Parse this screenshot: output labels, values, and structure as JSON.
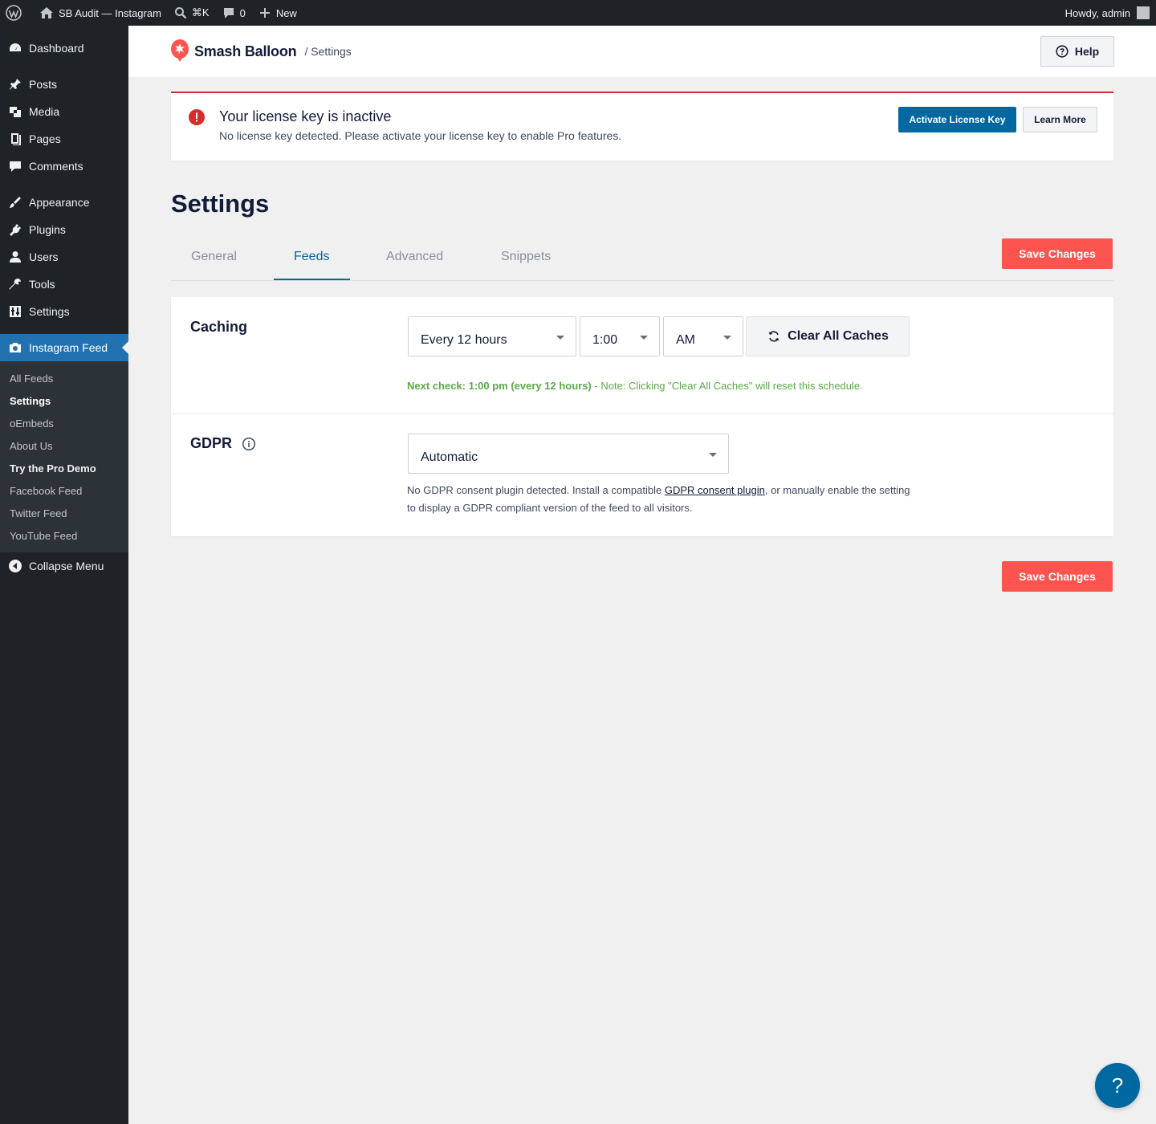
{
  "adminbar": {
    "site_name": "SB Audit — Instagram",
    "shortcut": "⌘K",
    "comments_count": "0",
    "new_label": "New",
    "greeting": "Howdy, admin"
  },
  "sidebar": {
    "items": [
      {
        "label": "Dashboard",
        "icon": "dashboard-icon"
      },
      {
        "label": "Posts",
        "icon": "pin-icon"
      },
      {
        "label": "Media",
        "icon": "media-icon"
      },
      {
        "label": "Pages",
        "icon": "pages-icon"
      },
      {
        "label": "Comments",
        "icon": "comment-icon"
      },
      {
        "label": "Appearance",
        "icon": "brush-icon"
      },
      {
        "label": "Plugins",
        "icon": "plugin-icon"
      },
      {
        "label": "Users",
        "icon": "user-icon"
      },
      {
        "label": "Tools",
        "icon": "wrench-icon"
      },
      {
        "label": "Settings",
        "icon": "settings-icon"
      },
      {
        "label": "Instagram Feed",
        "icon": "camera-icon"
      }
    ],
    "submenu": [
      "All Feeds",
      "Settings",
      "oEmbeds",
      "About Us",
      "Try the Pro Demo",
      "Facebook Feed",
      "Twitter Feed",
      "YouTube Feed"
    ],
    "collapse_label": "Collapse Menu"
  },
  "header": {
    "brand": "Smash Balloon",
    "breadcrumb": "/ Settings",
    "help_label": "Help"
  },
  "notice": {
    "title": "Your license key is inactive",
    "description": "No license key detected. Please activate your license key to enable Pro features.",
    "activate_label": "Activate License Key",
    "learn_label": "Learn More"
  },
  "page": {
    "title": "Settings",
    "tabs": [
      "General",
      "Feeds",
      "Advanced",
      "Snippets"
    ],
    "active_tab": "Feeds",
    "save_label": "Save Changes"
  },
  "caching": {
    "label": "Caching",
    "frequency": "Every 12 hours",
    "time": "1:00",
    "ampm": "AM",
    "clear_label": "Clear All Caches",
    "next_check": "Next check: 1:00 pm (every 12 hours)",
    "note": " - Note: Clicking \"Clear All Caches\" will reset this schedule."
  },
  "gdpr": {
    "label": "GDPR",
    "value": "Automatic",
    "desc_before": "No GDPR consent plugin detected. Install a compatible ",
    "desc_link": "GDPR consent plugin",
    "desc_after": ", or manually enable the setting to display a GDPR compliant version of the feed to all visitors."
  },
  "float_help": "?",
  "colors": {
    "accent": "#0068a0",
    "save": "#fe544f",
    "error": "#d72c2c",
    "success": "#59ab46"
  }
}
